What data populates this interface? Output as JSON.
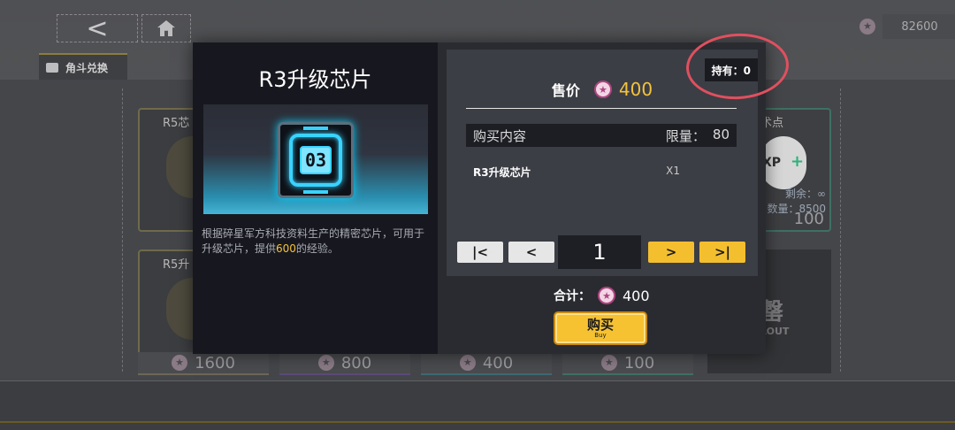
{
  "background": {
    "currency_value": "82600",
    "tab_label": "角斗兑换",
    "back_glyph": "<",
    "cards": [
      {
        "title": "R5芯",
        "price": "1600"
      },
      {
        "title": "R5升",
        "price": "800"
      },
      {
        "title": "",
        "price": "400"
      },
      {
        "title": "",
        "price": "100"
      }
    ],
    "top_card_price": "",
    "right_card": {
      "title": "术点",
      "xp": "XP",
      "remaining": "剩余：∞",
      "count": "数量：8500",
      "price": "100"
    },
    "sold_out": {
      "big": "罄",
      "small": "LOUT"
    }
  },
  "modal": {
    "item_name": "R3升级芯片",
    "chip_label": "03",
    "description_1": "根据碎星军方科技资料生产的精密芯片，可用于升级芯片，提供",
    "description_highlight": "600",
    "description_2": "的经验。",
    "owned": "持有：0",
    "sale_label": "售价",
    "sale_price": "400",
    "table_header": "购买内容",
    "limit_label": "限量：",
    "limit_value": "80",
    "content_name": "R3升级芯片",
    "content_qty": "X1",
    "quantity": "1",
    "btn_first": "|<",
    "btn_prev": "<",
    "btn_next": ">",
    "btn_last": ">|",
    "total_label": "合计：",
    "total_value": "400",
    "buy_label": "购买",
    "buy_sub": "Buy"
  },
  "colors": {
    "accent": "#f4bf2e",
    "price_gold": "#f3c33c",
    "chip_cyan": "#39d3ff",
    "annotation_red": "#e0505f"
  },
  "icons": {
    "back": "back-arrow-icon",
    "home": "home-icon",
    "gem": "star-gem-icon"
  }
}
